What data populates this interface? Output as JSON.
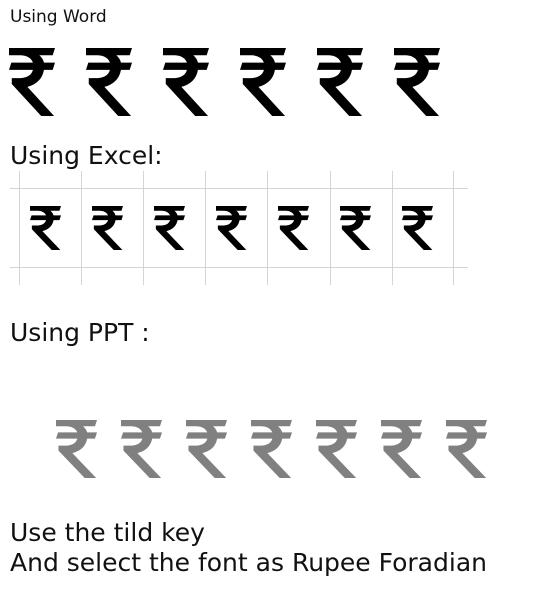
{
  "sections": {
    "word": {
      "label": "Using Word",
      "symbol": "₹",
      "count": 6,
      "color": "#000000"
    },
    "excel": {
      "label": "Using Excel:",
      "symbol": "₹",
      "count": 7,
      "color": "#000000",
      "gridline_color": "#d4d4d4"
    },
    "ppt": {
      "label": "Using PPT :",
      "symbol": "₹",
      "count": 7,
      "color": "#808080"
    }
  },
  "instructions": {
    "line1": "Use the tild key",
    "line2": "And select the font as Rupee Foradian"
  }
}
